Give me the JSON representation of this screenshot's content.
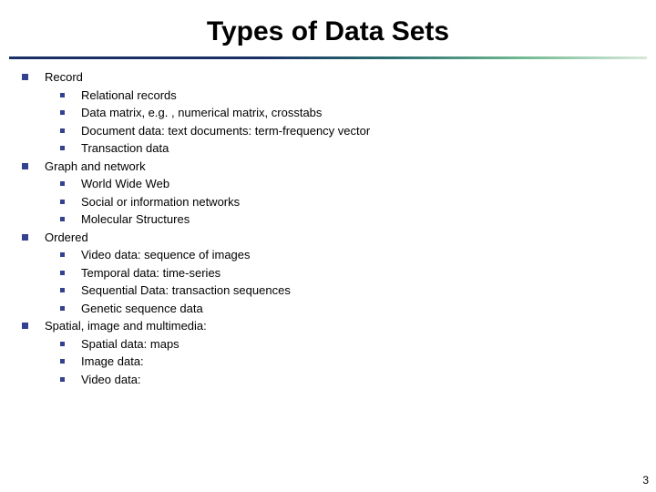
{
  "title": "Types of Data Sets",
  "page_number": "3",
  "sections": [
    {
      "heading": "Record",
      "items": [
        "Relational records",
        "Data matrix, e.g. , numerical matrix, crosstabs",
        "Document data: text documents: term-frequency vector",
        "Transaction data"
      ]
    },
    {
      "heading": "Graph and network",
      "items": [
        "World Wide Web",
        "Social or information networks",
        "Molecular Structures"
      ]
    },
    {
      "heading": "Ordered",
      "items": [
        "Video data: sequence of images",
        "Temporal data: time-series",
        "Sequential Data: transaction sequences",
        "Genetic sequence data"
      ]
    },
    {
      "heading": "Spatial, image and multimedia:",
      "items": [
        "Spatial data: maps",
        "Image data:",
        "Video data:"
      ]
    }
  ]
}
